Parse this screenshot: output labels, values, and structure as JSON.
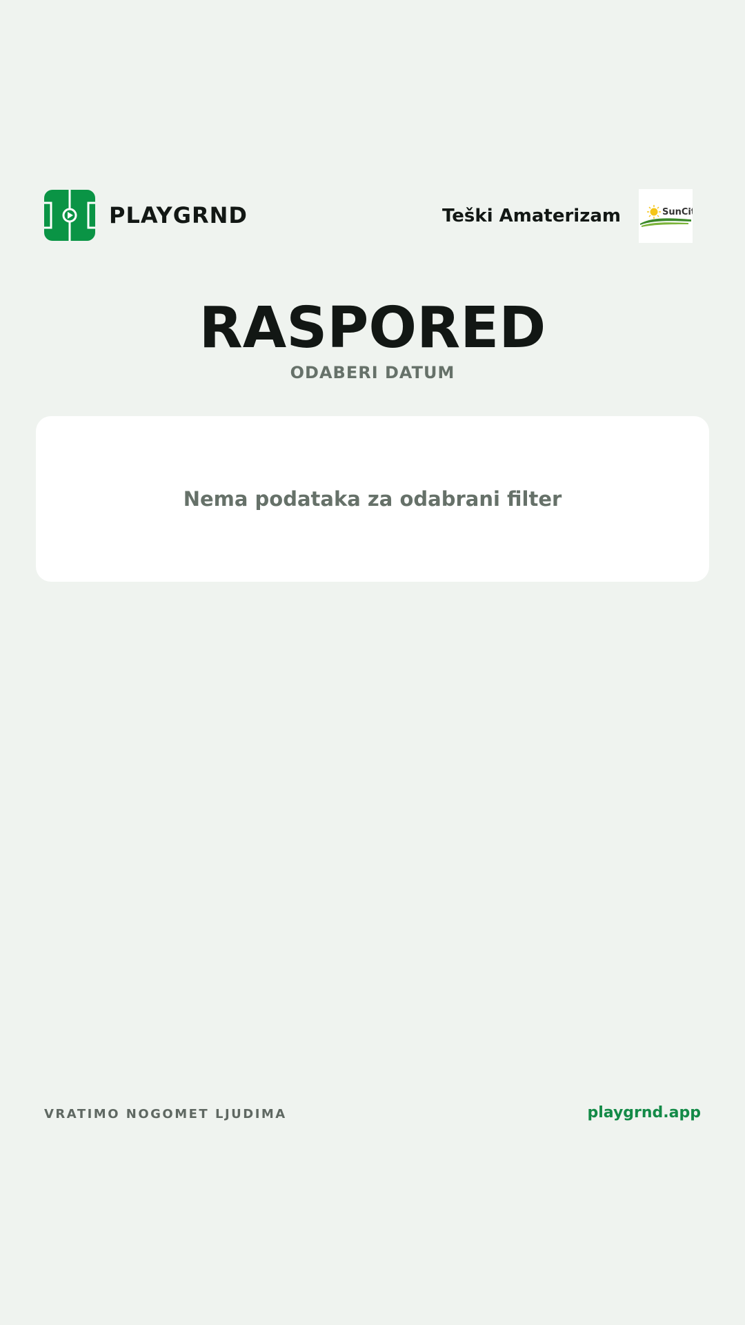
{
  "header": {
    "brand_name": "PLAYGRND",
    "brand_logo_icon": "football-pitch-icon",
    "team_name": "Teški Amaterizam",
    "sponsor_logo_text": "SunCity"
  },
  "main": {
    "title": "RASPORED",
    "subtitle": "ODABERI DATUM",
    "empty_message": "Nema podataka za odabrani filter"
  },
  "footer": {
    "slogan": "VRATIMO NOGOMET LJUDIMA",
    "link": "playgrnd.app"
  },
  "colors": {
    "background": "#eff3ef",
    "brand_green": "#0a9445",
    "link_green": "#138a47",
    "text_dark": "#121714",
    "text_muted": "#667169",
    "card": "#ffffff"
  }
}
